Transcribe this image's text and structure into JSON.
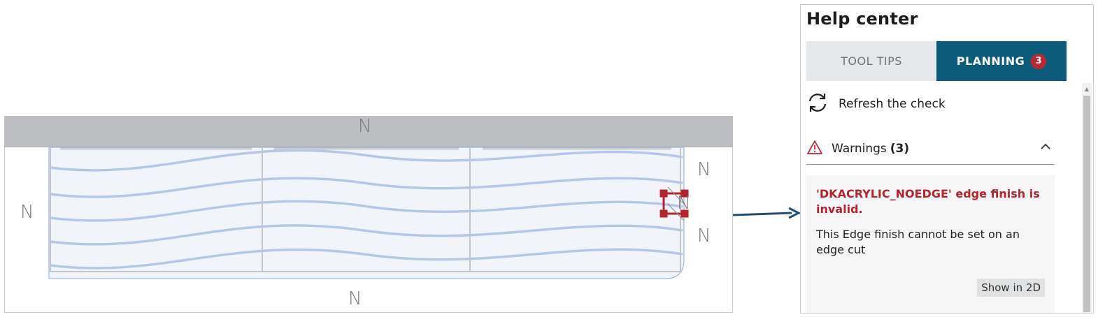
{
  "canvas": {
    "markers": {
      "top": "N",
      "left": "N",
      "right_upper": "N",
      "right_middle": "N",
      "right_lower": "N",
      "bottom": "N"
    }
  },
  "help_center": {
    "title": "Help center",
    "tabs": [
      {
        "label": "TOOL TIPS",
        "active": false
      },
      {
        "label": "PLANNING",
        "active": true,
        "badge": "3"
      }
    ],
    "refresh_label": "Refresh the check",
    "warnings": {
      "label": "Warnings",
      "count": "(3)",
      "expanded": true,
      "items": [
        {
          "title": "'DKACRYLIC_NOEDGE' edge finish is invalid.",
          "description": "This Edge finish cannot be set on an edge cut",
          "action_label": "Show in 2D"
        }
      ]
    }
  },
  "colors": {
    "tab_active_bg": "#0b5b7a",
    "badge_bg": "#c0262d",
    "warning_title": "#b8232b",
    "wood_grain": "#aec3e6",
    "selection_handle": "#c0262d",
    "arrow": "#1f4e79"
  },
  "icons": {
    "refresh": "refresh-icon",
    "warning": "warning-triangle-icon",
    "collapse": "chevron-up-icon",
    "scroll_up": "triangle-up-icon"
  }
}
